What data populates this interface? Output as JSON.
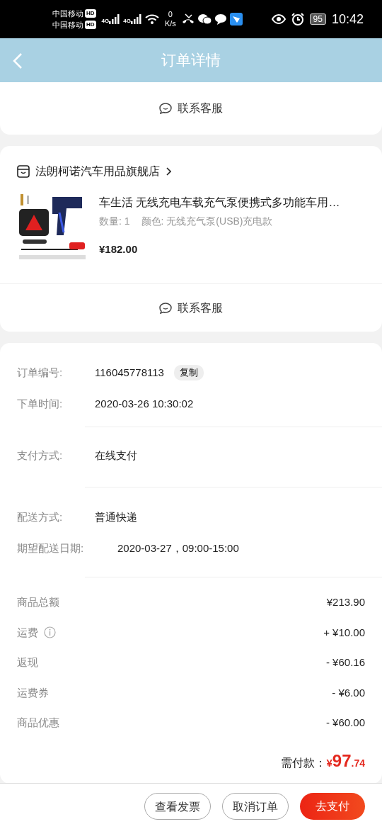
{
  "status_bar": {
    "carriers": [
      {
        "name": "中国移动",
        "badge": "HD"
      },
      {
        "name": "中国移动",
        "badge": "HD"
      }
    ],
    "networks": [
      "4G",
      "4G"
    ],
    "speed": {
      "value": "0",
      "unit": "K/s"
    },
    "battery": "95",
    "time": "10:42"
  },
  "header": {
    "title": "订单详情"
  },
  "top_card": {
    "contact": "联系客服"
  },
  "shop": {
    "name": "法朗柯诺汽车用品旗舰店"
  },
  "product": {
    "title": "车生活 无线充电车载充气泵便携式多功能车用…",
    "quantity": "数量: 1",
    "variant": "颜色: 无线充气泵(USB)充电款",
    "price": "¥182.00",
    "kind": "picture"
  },
  "shop_contact": "联系客服",
  "order_info": [
    [
      {
        "label": "订单编号:",
        "value": "116045778113",
        "action": "复制"
      },
      {
        "label": "下单时间:",
        "value": "2020-03-26 10:30:02"
      }
    ],
    [
      {
        "label": "支付方式:",
        "value": "在线支付"
      }
    ],
    [
      {
        "label": "配送方式:",
        "value": "普通快递"
      },
      {
        "label": "期望配送日期:",
        "value": "2020-03-27，09:00-15:00"
      }
    ]
  ],
  "fees": [
    {
      "label": "商品总额",
      "value": "¥213.90",
      "info": false
    },
    {
      "label": "运费",
      "value": "+ ¥10.00",
      "info": true
    },
    {
      "label": "返现",
      "value": "- ¥60.16",
      "info": false
    },
    {
      "label": "运费券",
      "value": "- ¥6.00",
      "info": false
    },
    {
      "label": "商品优惠",
      "value": "- ¥60.00",
      "info": false
    }
  ],
  "total": {
    "label": "需付款：",
    "currency": "¥",
    "integer": "97",
    "decimal": ".74"
  },
  "actions": [
    {
      "label": "查看发票",
      "kind": "outline"
    },
    {
      "label": "取消订单",
      "kind": "outline"
    },
    {
      "label": "去支付",
      "kind": "primary"
    }
  ]
}
